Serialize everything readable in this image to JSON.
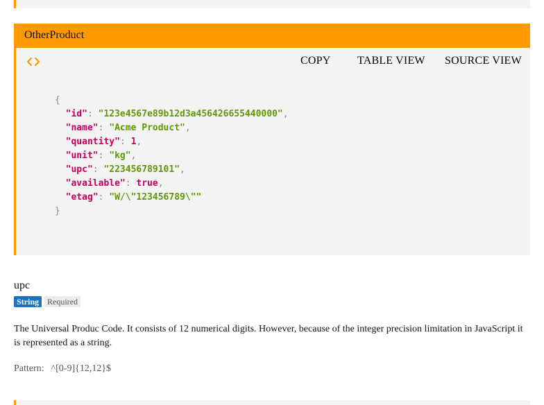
{
  "schema": {
    "title": "OtherProduct",
    "toolbar": {
      "copy_label": "COPY",
      "table_view_label": "TABLE VIEW",
      "source_view_label": "SOURCE VIEW",
      "toggle_icon": "code-brackets-icon"
    },
    "example": {
      "open_brace": "{",
      "close_brace": "}",
      "fields": [
        {
          "key": "\"id\"",
          "value": "\"123e4567e89b12d3a456426655440000\"",
          "type": "string"
        },
        {
          "key": "\"name\"",
          "value": "\"Acme Product\"",
          "type": "string"
        },
        {
          "key": "\"quantity\"",
          "value": "1",
          "type": "number"
        },
        {
          "key": "\"unit\"",
          "value": "\"kg\"",
          "type": "string"
        },
        {
          "key": "\"upc\"",
          "value": "\"223456789101\"",
          "type": "string"
        },
        {
          "key": "\"available\"",
          "value": "true",
          "type": "boolean"
        },
        {
          "key": "\"etag\"",
          "value": "\"W/\\\"123456789\\\"\"",
          "type": "string"
        }
      ]
    }
  },
  "property": {
    "name": "upc",
    "type_badge": "String",
    "required_badge": "Required",
    "description": "The Universal Produc Code. It consists of 12 numerical digits. However, because of the integer precision limitation in JavaScript it is represented as a string.",
    "pattern_label": "Pattern:",
    "pattern_value": "^[0-9]{12,12}$"
  },
  "colors": {
    "accent": "#ff9900",
    "panel_bg": "#f4f4f4",
    "json_key": "#c7005c",
    "json_string": "#5b9a00",
    "type_badge": "#1e73be"
  }
}
